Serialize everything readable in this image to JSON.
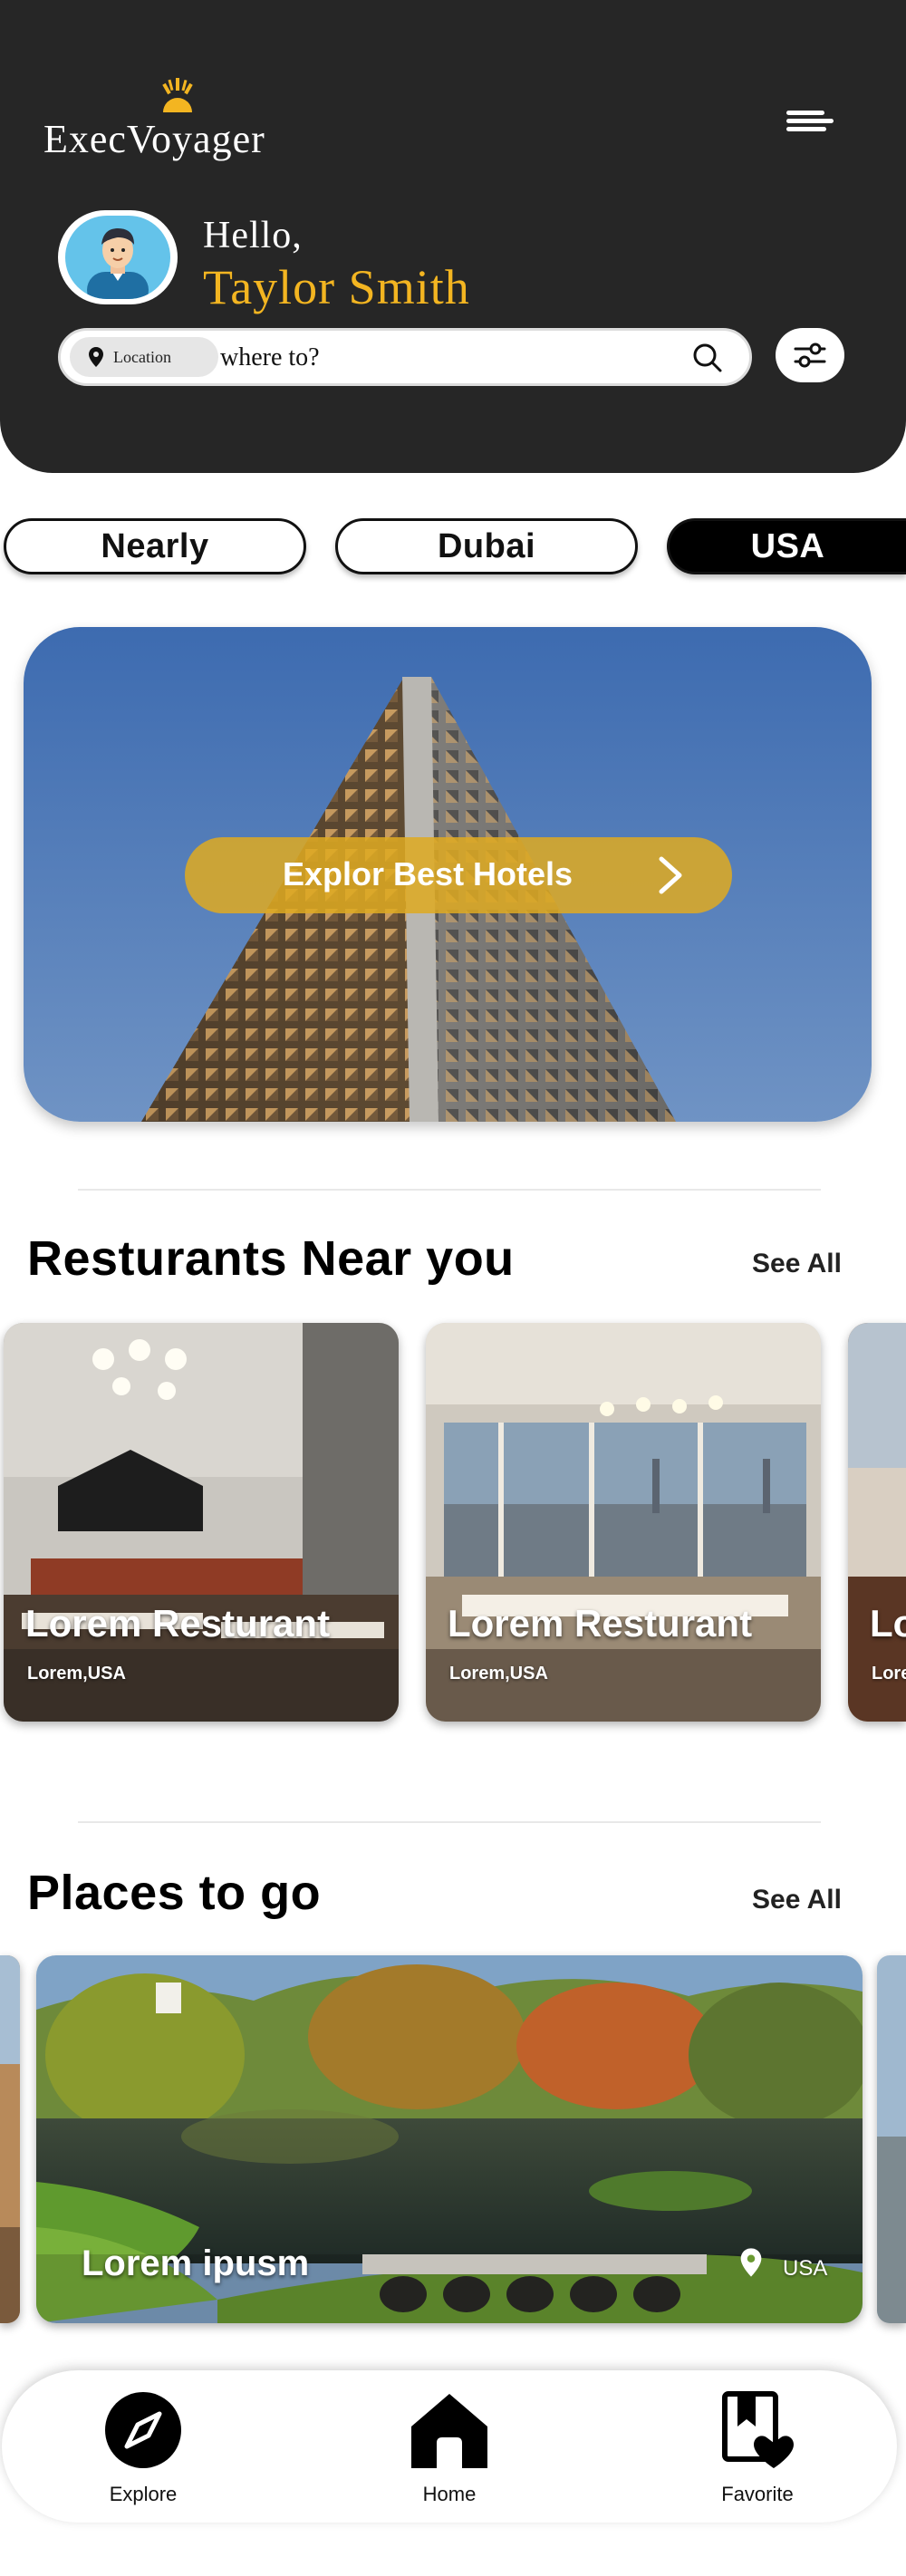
{
  "app": {
    "name": "ExecVoyager"
  },
  "header": {
    "greeting": "Hello,",
    "user_name": "Taylor Smith"
  },
  "search": {
    "location_chip": "Location",
    "placeholder": "where to?"
  },
  "location_tabs": [
    {
      "label": "Nearly",
      "active": false
    },
    {
      "label": "Dubai",
      "active": false
    },
    {
      "label": "USA",
      "active": true
    }
  ],
  "hero": {
    "button_label": "Explor Best Hotels"
  },
  "restaurants": {
    "title": "Resturants Near you",
    "see_all": "See All",
    "items": [
      {
        "name": "Lorem Resturant",
        "location": "Lorem,USA"
      },
      {
        "name": "Lorem Resturant",
        "location": "Lorem,USA"
      },
      {
        "name": "Lorem Resturant",
        "location": "Lorem,USA"
      }
    ]
  },
  "places": {
    "title": "Places to go",
    "see_all": "See All",
    "items": [
      {
        "name": "Lorem ipusm",
        "country": "USA"
      }
    ]
  },
  "bottom_nav": [
    {
      "label": "Explore",
      "icon": "compass-icon"
    },
    {
      "label": "Home",
      "icon": "home-icon"
    },
    {
      "label": "Favorite",
      "icon": "favorite-bookmark-icon"
    }
  ],
  "colors": {
    "header_bg": "#262626",
    "accent_gold": "#f3b521",
    "hero_button": "#deaa22",
    "active_tab": "#000000"
  }
}
